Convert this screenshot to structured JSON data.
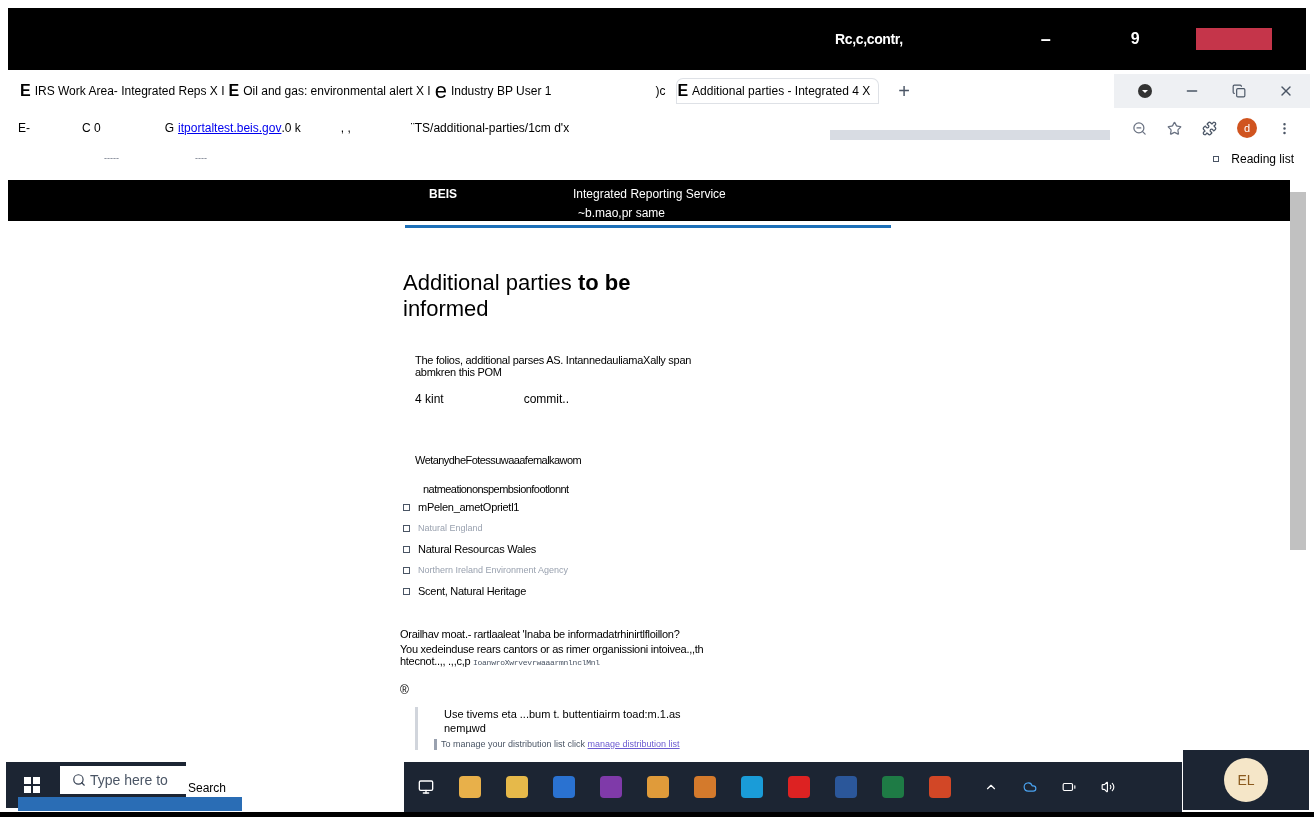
{
  "title_bar": {
    "title": "Rc,c,contr,",
    "minimize": "–",
    "badge": "9"
  },
  "tabs": [
    {
      "icon": "E",
      "label": "IRS Work Area- Integrated Reps X I",
      "selected": false
    },
    {
      "icon": "E",
      "label": "Oil and gas: environmental alert X I",
      "selected": false
    },
    {
      "icon": "e",
      "label": "Industry BP User 1",
      "selected": false
    },
    {
      "label": ")c",
      "selected": false
    },
    {
      "icon": "E",
      "label": "Additional parties - Integrated 4 X",
      "selected": true
    }
  ],
  "new_tab": "+",
  "address_bar": {
    "back": "E-",
    "reload": "C 0",
    "site_icon": "G",
    "host": "itportaltest.beis.gov",
    "host_rest": ".0 k",
    "marks": ", ,",
    "path": "¨TS/additional-parties/1cm d'x",
    "avatar": "d"
  },
  "bookmarks": {
    "items": [
      "-----",
      "----"
    ],
    "reading_list": "Reading list"
  },
  "header": {
    "brand": "BEIS",
    "service": "Integrated Reporting Service",
    "user": "~b.mao,pr same"
  },
  "page": {
    "heading": "Additional parties **to be** informed",
    "intro": "The folios, additional parses AS. IntannedauliamaXally span abmkren this POM",
    "row_left": "4 kint",
    "row_right": "commit..",
    "question": "WetanydheFotessuwaaafemalkawom",
    "hint": "natmeationonspembsionfootlonnt",
    "options": [
      {
        "label": "mPelen_ametOprietl1",
        "checked": false,
        "faded": false
      },
      {
        "label": "Natural England",
        "checked": false,
        "faded": true
      },
      {
        "label": "Natural Resourcas Wales",
        "checked": false,
        "faded": false
      },
      {
        "label": "Northern Ireland Environment Agency",
        "checked": false,
        "faded": true
      },
      {
        "label": "Scent, Natural Heritage",
        "checked": false,
        "faded": false
      }
    ],
    "other_question": "Orailhav moat.- rartlaaleat 'Inaba be informadatrhinirtlfloillon?",
    "other_hint": "You xedeinduse rears cantors or as rimer organissioni intoivea.,,th htecnot..,, .,,c,p",
    "other_code": "IoanwroXwrvevrwaaarmnlnclMnl",
    "radio_mark": "®",
    "inset_text": "Use tivems eta ...bum t. buttentiairm toad:m.1.as nemµwd",
    "inset_note": "To manage your distribution list click ",
    "inset_link": "manage distribution list"
  },
  "taskbar": {
    "search_placeholder": "Type here to",
    "search_label": "Search",
    "user": "EL"
  }
}
